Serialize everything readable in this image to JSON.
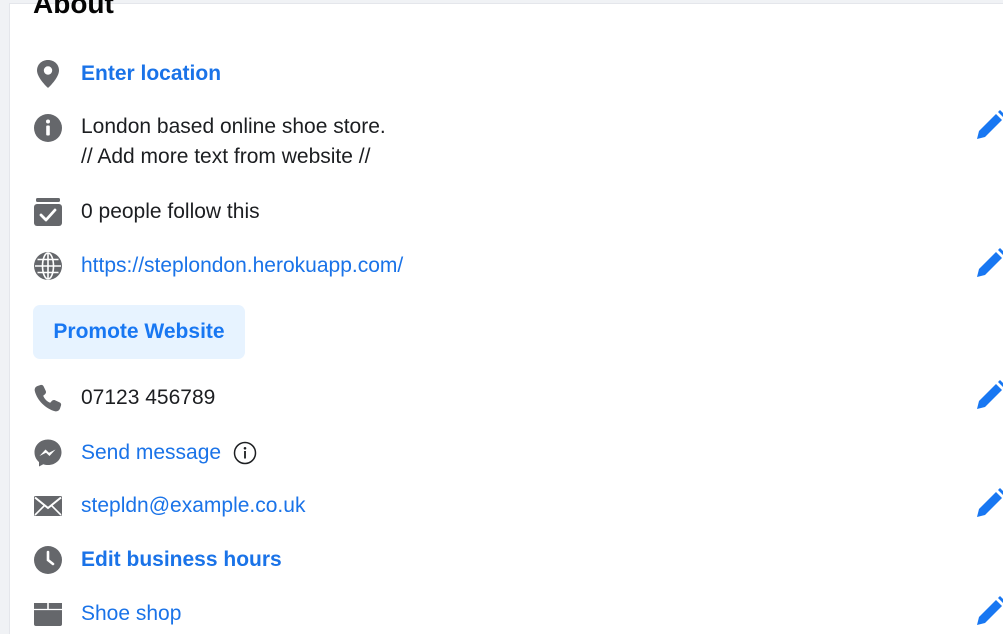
{
  "section": {
    "title": "About"
  },
  "about": {
    "location": "Enter location",
    "description_line1": "London based online shoe store.",
    "description_line2": "// Add more text from website //",
    "followers": "0 people follow this",
    "website": "https://steplondon.herokuapp.com/",
    "promote_button": "Promote Website",
    "phone": "07123 456789",
    "message": "Send message",
    "email": "stepldn@example.co.uk",
    "hours": "Edit business hours",
    "category": "Shoe shop"
  },
  "colors": {
    "link": "#1a73e8",
    "accent": "#1877f2",
    "icon_gray": "#65676b",
    "button_bg": "#e7f3ff"
  },
  "icons": {
    "location": "map-pin-icon",
    "description": "info-circle-icon",
    "followers": "check-box-icon",
    "website": "globe-icon",
    "phone": "phone-icon",
    "message": "messenger-icon",
    "message_info": "info-outline-icon",
    "email": "envelope-icon",
    "hours": "clock-icon",
    "category": "shop-tag-icon",
    "edit": "pencil-edit-icon"
  }
}
